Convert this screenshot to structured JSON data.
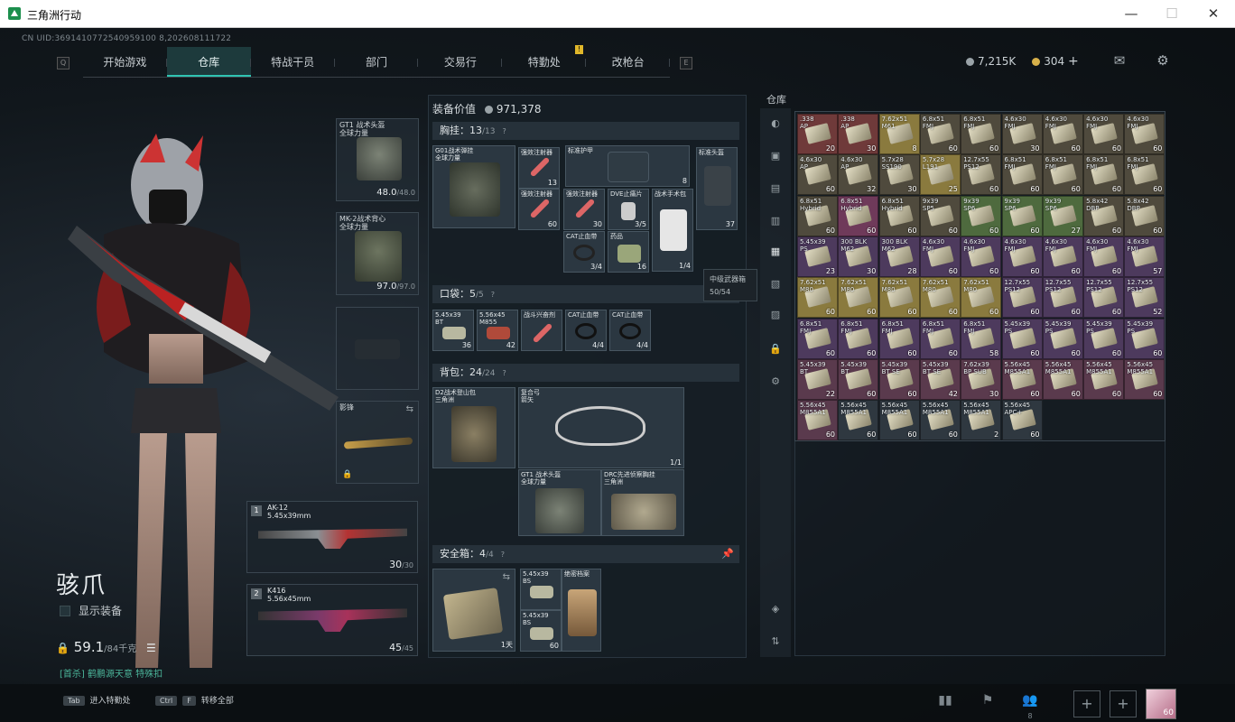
{
  "window": {
    "title": "三角洲行动",
    "minimize": "—",
    "maximize": "☐",
    "close": "✕"
  },
  "uid": "CN UID:3691410772540959100 8,202608111722",
  "nav": {
    "left_key": "Q",
    "right_key": "E",
    "alert": "!",
    "tabs": [
      "开始游戏",
      "仓库",
      "特战干员",
      "部门",
      "交易行",
      "特勤处",
      "改枪台"
    ],
    "active": "仓库"
  },
  "currency": {
    "silver": "7,215K",
    "gold": "304",
    "add": "+"
  },
  "equipment_slots": [
    {
      "label": "GT1 战术头盔\n全球力量",
      "value": "48.0",
      "max": "/48.0"
    },
    {
      "label": "MK-2战术背心\n全球力量",
      "value": "97.0",
      "max": "/97.0"
    },
    {
      "label": "",
      "value": "",
      "max": ""
    },
    {
      "label": "影锋",
      "value": "",
      "max": ""
    }
  ],
  "weapons": [
    {
      "num": "1",
      "name": "AK-12",
      "caliber": "5.45x39mm",
      "ammo": "30",
      "max": "/30"
    },
    {
      "num": "2",
      "name": "K416",
      "caliber": "5.56x45mm",
      "ammo": "45",
      "max": "/45"
    }
  ],
  "character": {
    "name": "骇爪",
    "show_equipment": "显示装备",
    "weight": "59.1",
    "weight_max": "/84千克",
    "quest": "[首杀] 鹤鹏源天意 特殊扣"
  },
  "middle": {
    "value_label": "装备价值",
    "value": "971,378",
    "chest": {
      "title": "胸挂：",
      "count": "13",
      "max": "/13",
      "q": "?"
    },
    "pocket": {
      "title": "口袋：",
      "count": "5",
      "max": "/5",
      "q": "?"
    },
    "backpack": {
      "title": "背包：",
      "count": "24",
      "max": "/24",
      "q": "?"
    },
    "safebox": {
      "title": "安全箱：",
      "count": "4",
      "max": "/4",
      "q": "?"
    },
    "chest_items": [
      {
        "label": "G01战术弹挂\n全球力量",
        "count": ""
      },
      {
        "label": "强效注射器",
        "count": "13"
      },
      {
        "label": "标准护甲",
        "count": "8"
      },
      {
        "label": "标准头盔",
        "count": "37"
      },
      {
        "label": "强效注射器",
        "count": "60"
      },
      {
        "label": "强效注射器",
        "count": "30"
      },
      {
        "label": "DVE止痛片",
        "count": "3/5"
      },
      {
        "label": "战术手术包",
        "count": "1/4"
      },
      {
        "label": "CAT止血带",
        "count": "3/4"
      },
      {
        "label": "药品",
        "count": "16"
      }
    ],
    "pocket_items": [
      {
        "label": "5.45x39\nBT",
        "count": "36"
      },
      {
        "label": "5.56x45\nM855",
        "count": "42"
      },
      {
        "label": "战斗兴奋剂",
        "count": ""
      },
      {
        "label": "CAT止血带",
        "count": "4/4"
      },
      {
        "label": "CAT止血带",
        "count": "4/4"
      }
    ],
    "backpack_items": [
      {
        "label": "D2战术登山包\n三角洲",
        "count": ""
      },
      {
        "label": "复合弓\n箭矢",
        "count": "1/1"
      },
      {
        "label": "GT1 战术头盔\n全球力量",
        "count": ""
      },
      {
        "label": "DRC先进侦察胸挂\n三角洲",
        "count": ""
      }
    ],
    "safebox_items": [
      {
        "label": "",
        "count": "1天"
      },
      {
        "label": "5.45x39\nBS",
        "count": ""
      },
      {
        "label": "绝密档案",
        "count": ""
      },
      {
        "label": "5.45x39\nBS",
        "count": "60"
      }
    ]
  },
  "tooltip": {
    "title": "中级武器箱",
    "value": "50/54"
  },
  "warehouse": {
    "title": "仓库",
    "cells": [
      [
        ".338\nAP",
        "20",
        "#6f3a3a"
      ],
      [
        ".338\nAP",
        "30",
        "#6f3a3a"
      ],
      [
        "7.62x51\nM61",
        "8",
        "#8a7a3e"
      ],
      [
        "6.8x51\nFMJ",
        "60",
        "#4f4a3d"
      ],
      [
        "6.8x51\nFMJ",
        "60",
        "#4f4a3d"
      ],
      [
        "4.6x30\nFMJ",
        "30",
        "#4f4a3d"
      ],
      [
        "4.6x30\nFMJ",
        "60",
        "#4f4a3d"
      ],
      [
        "4.6x30\nFMJ",
        "60",
        "#4f4a3d"
      ],
      [
        "4.6x30\nFMJ",
        "60",
        "#4f4a3d"
      ],
      [
        "4.6x30\nAP",
        "60",
        "#4f4a3d"
      ],
      [
        "4.6x30\nAP",
        "32",
        "#4f4a3d"
      ],
      [
        "5.7x28\nSS190",
        "30",
        "#4f4a3d"
      ],
      [
        "5.7x28\nL191",
        "25",
        "#8a7a3e"
      ],
      [
        "12.7x55\nPS12",
        "60",
        "#4f4a3d"
      ],
      [
        "6.8x51\nFMJ",
        "60",
        "#4f4a3d"
      ],
      [
        "6.8x51\nFMJ",
        "60",
        "#4f4a3d"
      ],
      [
        "6.8x51\nFMJ",
        "60",
        "#4f4a3d"
      ],
      [
        "6.8x51\nFMJ",
        "60",
        "#4f4a3d"
      ],
      [
        "6.8x51\nHybrid",
        "60",
        "#4f4a3d"
      ],
      [
        "6.8x51\nHybrid",
        "60",
        "#6f3a5a"
      ],
      [
        "6.8x51\nHybrid",
        "60",
        "#4f4a3d"
      ],
      [
        "9x39\nSP5",
        "60",
        "#4f4a3d"
      ],
      [
        "9x39\nSP6",
        "60",
        "#4e6a3e"
      ],
      [
        "9x39\nSP6",
        "60",
        "#4e6a3e"
      ],
      [
        "9x39\nSP6",
        "27",
        "#4e6a3e"
      ],
      [
        "5.8x42\nDBP",
        "60",
        "#4f4a3d"
      ],
      [
        "5.8x42\nDBP",
        "60",
        "#4f4a3d"
      ],
      [
        "5.45x39\nPS",
        "23",
        "#4d3a5d"
      ],
      [
        "300 BLK\nM62",
        "30",
        "#4d3a5d"
      ],
      [
        "300 BLK\nM62",
        "28",
        "#4d3a5d"
      ],
      [
        "4.6x30\nFMJ",
        "60",
        "#4d3a5d"
      ],
      [
        "4.6x30\nFMJ",
        "60",
        "#4d3a5d"
      ],
      [
        "4.6x30\nFMJ",
        "60",
        "#4d3a5d"
      ],
      [
        "4.6x30\nFMJ",
        "60",
        "#4d3a5d"
      ],
      [
        "4.6x30\nFMJ",
        "60",
        "#4d3a5d"
      ],
      [
        "4.6x30\nFMJ",
        "57",
        "#4d3a5d"
      ],
      [
        "7.62x51\nM80",
        "60",
        "#8a7a3e"
      ],
      [
        "7.62x51\nM80",
        "60",
        "#8a7a3e"
      ],
      [
        "7.62x51\nM80",
        "60",
        "#8a7a3e"
      ],
      [
        "7.62x51\nM80",
        "60",
        "#8a7a3e"
      ],
      [
        "7.62x51\nM80",
        "60",
        "#8a7a3e"
      ],
      [
        "12.7x55\nPS12",
        "60",
        "#4d3a5d"
      ],
      [
        "12.7x55\nPS12",
        "60",
        "#4d3a5d"
      ],
      [
        "12.7x55\nPS12",
        "60",
        "#4d3a5d"
      ],
      [
        "12.7x55\nPS12",
        "52",
        "#4d3a5d"
      ],
      [
        "6.8x51\nFMJ",
        "60",
        "#4d3a5d"
      ],
      [
        "6.8x51\nFMJ",
        "60",
        "#4d3a5d"
      ],
      [
        "6.8x51\nFMJ",
        "60",
        "#4d3a5d"
      ],
      [
        "6.8x51\nFMJ",
        "60",
        "#4d3a5d"
      ],
      [
        "6.8x51\nFMJ",
        "58",
        "#4d3a5d"
      ],
      [
        "5.45x39\nPS",
        "60",
        "#4d3a5d"
      ],
      [
        "5.45x39\nPS",
        "60",
        "#4d3a5d"
      ],
      [
        "5.45x39\nPS",
        "60",
        "#4d3a5d"
      ],
      [
        "5.45x39\nPS",
        "60",
        "#4d3a5d"
      ],
      [
        "5.45x39\nBT",
        "22",
        "#5a3a4d"
      ],
      [
        "5.45x39\nBT",
        "60",
        "#5a3a4d"
      ],
      [
        "5.45x39\nBT SE",
        "60",
        "#5a3a4d"
      ],
      [
        "5.45x39\nBT SE",
        "42",
        "#5a3a4d"
      ],
      [
        "7.62x39\nBP SUB",
        "30",
        "#5a3a4d"
      ],
      [
        "5.56x45\nM855A1",
        "60",
        "#5a3a4d"
      ],
      [
        "5.56x45\nM855A1",
        "60",
        "#5a3a4d"
      ],
      [
        "5.56x45\nM855A1",
        "60",
        "#5a3a4d"
      ],
      [
        "5.56x45\nM855A1",
        "60",
        "#5a3a4d"
      ],
      [
        "5.56x45\nM855A1",
        "60",
        "#5a3a4d"
      ],
      [
        "5.56x45\nM855A1",
        "60",
        "#2f3840"
      ],
      [
        "5.56x45\nM855A1",
        "60",
        "#2f3840"
      ],
      [
        "5.56x45\nM855A1",
        "60",
        "#2f3840"
      ],
      [
        "5.56x45\nM855A1",
        "2",
        "#2f3840"
      ],
      [
        "5.56x45\nAPC+",
        "60",
        "#2f3840"
      ]
    ]
  },
  "bottom": {
    "tab_key": "Tab",
    "tab_hint": "进入特勤处",
    "ctrl_key": "Ctrl",
    "f_key": "F",
    "ctrl_hint": "转移全部",
    "plus": "+",
    "friends": "8",
    "avatar_level": "60"
  }
}
